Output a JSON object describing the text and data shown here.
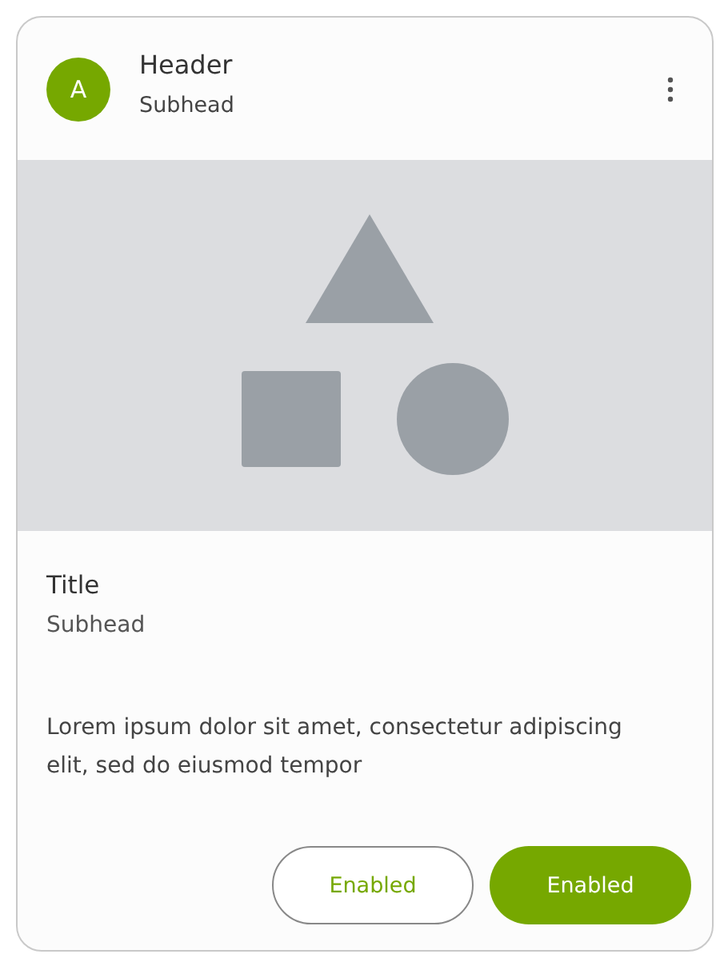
{
  "header": {
    "avatar": "A",
    "title": "Header",
    "subhead": "Subhead"
  },
  "media": {
    "kind": "shapes"
  },
  "content": {
    "title": "Title",
    "subhead": "Subhead",
    "body": "Lorem ipsum dolor sit amet, consectetur adipiscing elit, sed do eiusmod tempor"
  },
  "buttons": [
    {
      "label": "Enabled",
      "kind": "outlined"
    },
    {
      "label": "Enabled",
      "kind": "filled"
    }
  ]
}
